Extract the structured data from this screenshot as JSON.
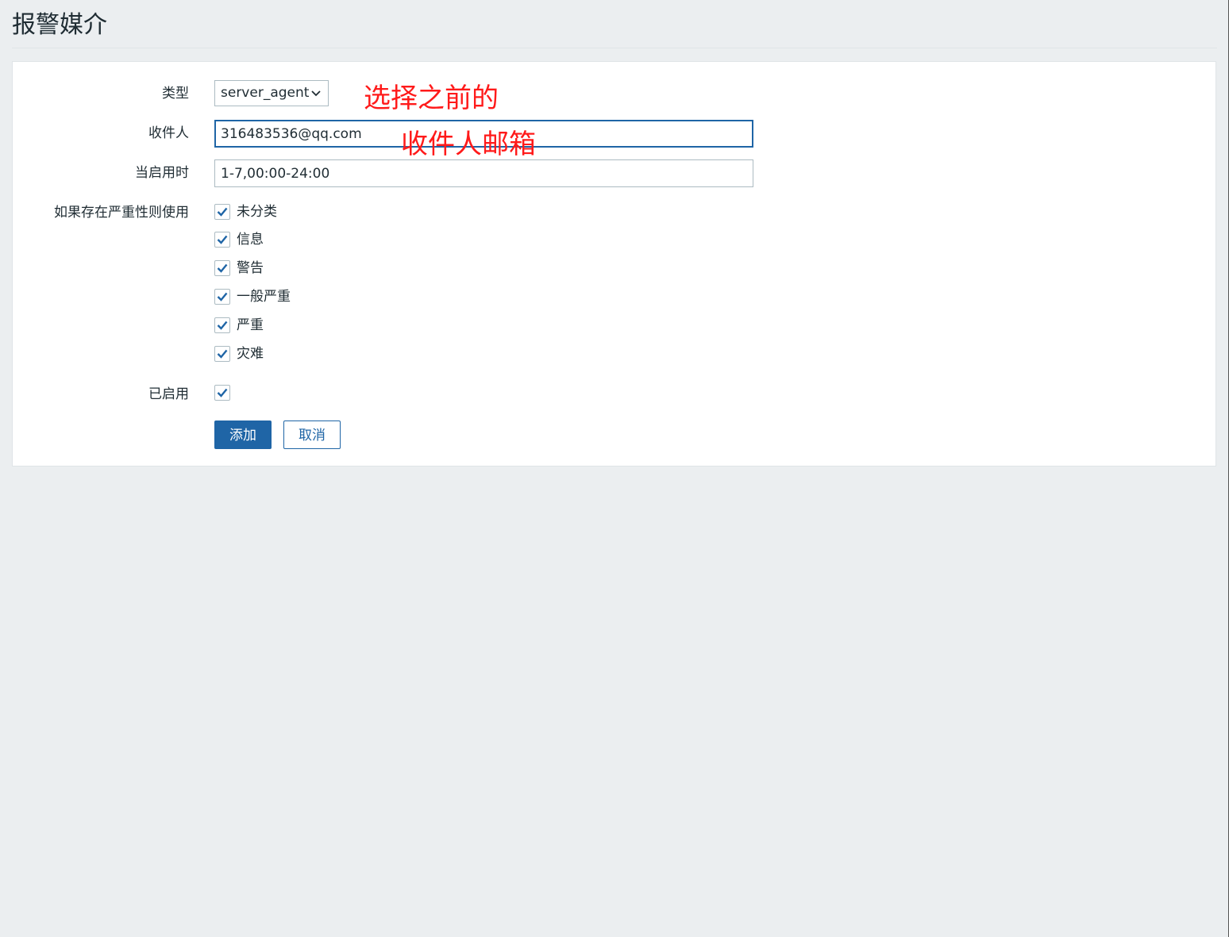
{
  "page": {
    "title": "报警媒介"
  },
  "form": {
    "type": {
      "label": "类型",
      "value": "server_agent"
    },
    "recipient": {
      "label": "收件人",
      "value": "316483536@qq.com"
    },
    "when_active": {
      "label": "当启用时",
      "value": "1-7,00:00-24:00"
    },
    "severity": {
      "label": "如果存在严重性则使用",
      "options": [
        {
          "label": "未分类",
          "checked": true
        },
        {
          "label": "信息",
          "checked": true
        },
        {
          "label": "警告",
          "checked": true
        },
        {
          "label": "一般严重",
          "checked": true
        },
        {
          "label": "严重",
          "checked": true
        },
        {
          "label": "灾难",
          "checked": true
        }
      ]
    },
    "enabled": {
      "label": "已启用",
      "checked": true
    },
    "buttons": {
      "add_label": "添加",
      "cancel_label": "取消"
    }
  },
  "annotations": {
    "line1": "选择之前的",
    "line2": "收件人邮箱"
  },
  "colors": {
    "background": "#ebeef0",
    "panel": "#ffffff",
    "primary": "#1f65a6",
    "annotation": "#ff1a1a"
  }
}
